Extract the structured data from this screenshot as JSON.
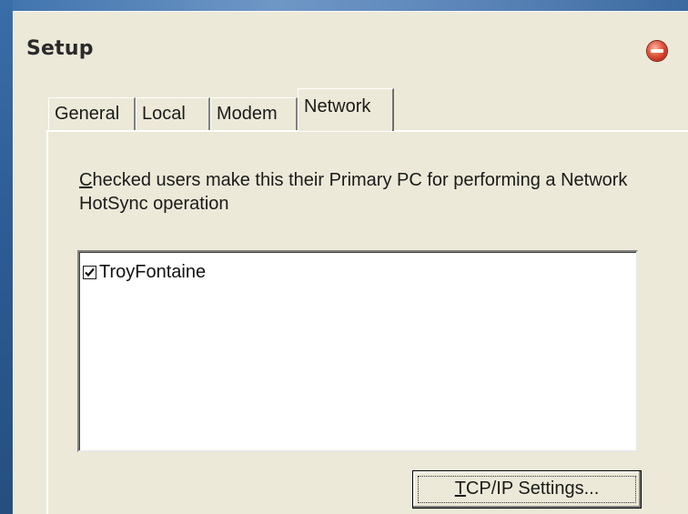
{
  "window": {
    "title": "Setup"
  },
  "tabs": [
    {
      "label": "General",
      "active": false
    },
    {
      "label": "Local",
      "active": false
    },
    {
      "label": "Modem",
      "active": false
    },
    {
      "label": "Network",
      "active": true
    }
  ],
  "network_panel": {
    "description_first_letter": "C",
    "description_rest": "hecked users make this their Primary PC for performing a Network HotSync operation",
    "users": [
      {
        "name": "TroyFontaine",
        "checked": true
      }
    ],
    "tcp_button": {
      "underlined_letter": "T",
      "label_rest": "CP/IP Settings..."
    }
  },
  "icons": {
    "close": "close-icon",
    "checkmark": "checkmark-icon"
  }
}
